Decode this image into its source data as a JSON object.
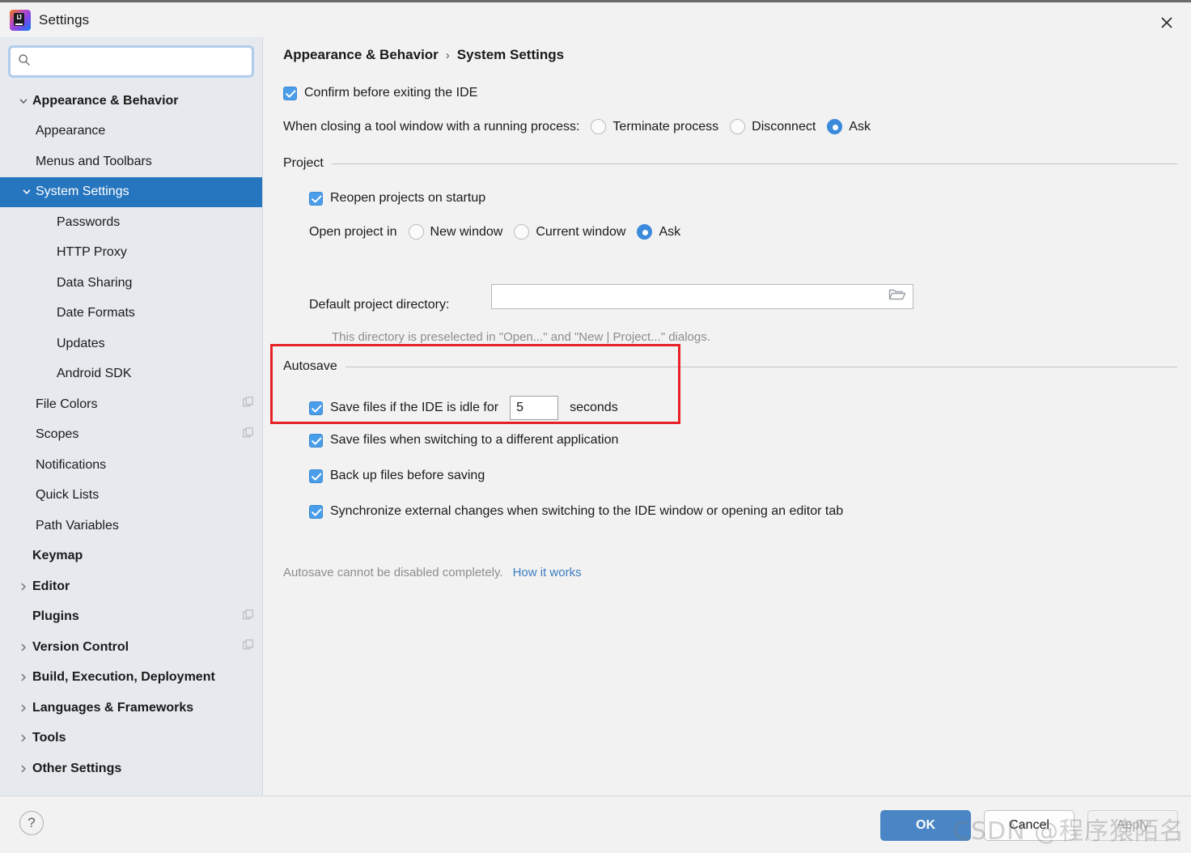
{
  "window": {
    "title": "Settings",
    "logo_icon": "intellij-idea-logo",
    "close_icon": "close-icon"
  },
  "search": {
    "value": "",
    "placeholder": "",
    "icon": "search-icon"
  },
  "sidebar": {
    "items": [
      {
        "label": "Appearance & Behavior",
        "level": 0,
        "bold": true,
        "chevron": "chevron-down",
        "selected": false,
        "copy_icon": false
      },
      {
        "label": "Appearance",
        "level": 1,
        "bold": false,
        "chevron": "",
        "selected": false,
        "copy_icon": false
      },
      {
        "label": "Menus and Toolbars",
        "level": 1,
        "bold": false,
        "chevron": "",
        "selected": false,
        "copy_icon": false
      },
      {
        "label": "System Settings",
        "level": 1,
        "bold": false,
        "chevron": "chevron-down",
        "selected": true,
        "copy_icon": false
      },
      {
        "label": "Passwords",
        "level": 2,
        "bold": false,
        "chevron": "",
        "selected": false,
        "copy_icon": false
      },
      {
        "label": "HTTP Proxy",
        "level": 2,
        "bold": false,
        "chevron": "",
        "selected": false,
        "copy_icon": false
      },
      {
        "label": "Data Sharing",
        "level": 2,
        "bold": false,
        "chevron": "",
        "selected": false,
        "copy_icon": false
      },
      {
        "label": "Date Formats",
        "level": 2,
        "bold": false,
        "chevron": "",
        "selected": false,
        "copy_icon": false
      },
      {
        "label": "Updates",
        "level": 2,
        "bold": false,
        "chevron": "",
        "selected": false,
        "copy_icon": false
      },
      {
        "label": "Android SDK",
        "level": 2,
        "bold": false,
        "chevron": "",
        "selected": false,
        "copy_icon": false
      },
      {
        "label": "File Colors",
        "level": 1,
        "bold": false,
        "chevron": "",
        "selected": false,
        "copy_icon": true
      },
      {
        "label": "Scopes",
        "level": 1,
        "bold": false,
        "chevron": "",
        "selected": false,
        "copy_icon": true
      },
      {
        "label": "Notifications",
        "level": 1,
        "bold": false,
        "chevron": "",
        "selected": false,
        "copy_icon": false
      },
      {
        "label": "Quick Lists",
        "level": 1,
        "bold": false,
        "chevron": "",
        "selected": false,
        "copy_icon": false
      },
      {
        "label": "Path Variables",
        "level": 1,
        "bold": false,
        "chevron": "",
        "selected": false,
        "copy_icon": false
      },
      {
        "label": "Keymap",
        "level": 0,
        "bold": true,
        "chevron": "",
        "selected": false,
        "copy_icon": false
      },
      {
        "label": "Editor",
        "level": 0,
        "bold": true,
        "chevron": "chevron-right",
        "selected": false,
        "copy_icon": false
      },
      {
        "label": "Plugins",
        "level": 0,
        "bold": true,
        "chevron": "",
        "selected": false,
        "copy_icon": true
      },
      {
        "label": "Version Control",
        "level": 0,
        "bold": true,
        "chevron": "chevron-right",
        "selected": false,
        "copy_icon": true
      },
      {
        "label": "Build, Execution, Deployment",
        "level": 0,
        "bold": true,
        "chevron": "chevron-right",
        "selected": false,
        "copy_icon": false
      },
      {
        "label": "Languages & Frameworks",
        "level": 0,
        "bold": true,
        "chevron": "chevron-right",
        "selected": false,
        "copy_icon": false
      },
      {
        "label": "Tools",
        "level": 0,
        "bold": true,
        "chevron": "chevron-right",
        "selected": false,
        "copy_icon": false
      },
      {
        "label": "Other Settings",
        "level": 0,
        "bold": true,
        "chevron": "chevron-right",
        "selected": false,
        "copy_icon": false
      }
    ]
  },
  "breadcrumb": {
    "parent": "Appearance & Behavior",
    "separator": "›",
    "current": "System Settings"
  },
  "main": {
    "confirm_exit": {
      "label": "Confirm before exiting the IDE",
      "checked": true
    },
    "closing_tool_window": {
      "label": "When closing a tool window with a running process:",
      "options": [
        {
          "label": "Terminate process",
          "selected": false
        },
        {
          "label": "Disconnect",
          "selected": false
        },
        {
          "label": "Ask",
          "selected": true
        }
      ]
    },
    "project_section": {
      "title": "Project",
      "reopen": {
        "label": "Reopen projects on startup",
        "checked": true
      },
      "open_project_in": {
        "label": "Open project in",
        "options": [
          {
            "label": "New window",
            "selected": false
          },
          {
            "label": "Current window",
            "selected": false
          },
          {
            "label": "Ask",
            "selected": true
          }
        ]
      },
      "default_dir": {
        "label": "Default project directory:",
        "value": "",
        "placeholder": "",
        "browse_icon": "folder-icon"
      },
      "hint": "This directory is preselected in \"Open...\" and \"New | Project...\" dialogs."
    },
    "autosave_section": {
      "title": "Autosave",
      "highlighted": true,
      "highlight_color": "#e82127",
      "idle_save": {
        "label_before": "Save files if the IDE is idle for",
        "value": "5",
        "label_after": "seconds",
        "checked": true
      },
      "checkboxes": [
        {
          "label": "Save files when switching to a different application",
          "checked": true
        },
        {
          "label": "Back up files before saving",
          "checked": true
        },
        {
          "label": "Synchronize external changes when switching to the IDE window or opening an editor tab",
          "checked": true
        }
      ],
      "note": "Autosave cannot be disabled completely.",
      "link": "How it works"
    }
  },
  "footer": {
    "help_label": "?",
    "ok_label": "OK",
    "cancel_label": "Cancel",
    "apply_label": "Apply",
    "apply_disabled": true
  },
  "watermark": {
    "text": "CSDN @程序猿陌名丨"
  },
  "colors": {
    "accent_blue": "#2675bf",
    "checkbox_blue": "#4a9de8",
    "radio_blue": "#3c8adc",
    "link_blue": "#3a7bbf",
    "sidebar_bg": "#e6eaee",
    "panel_bg": "#f2f2f2",
    "highlight_red": "#e82127"
  }
}
